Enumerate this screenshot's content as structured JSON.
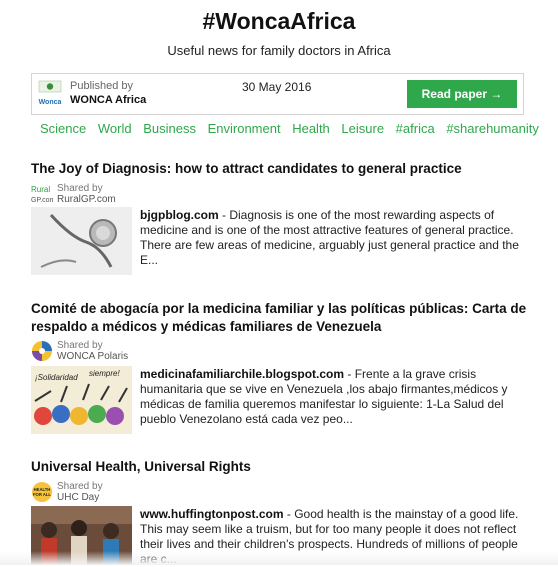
{
  "header": {
    "title": "#WoncaAfrica",
    "subtitle": "Useful news for family doctors in Africa"
  },
  "publisher": {
    "logo_text": "Wonca",
    "published_by_label": "Published by",
    "name": "WONCA Africa",
    "date": "30 May 2016",
    "read_button": "Read paper →"
  },
  "categories": [
    "Science",
    "World",
    "Business",
    "Environment",
    "Health",
    "Leisure",
    "#africa",
    "#sharehumanity"
  ],
  "articles": [
    {
      "title": "The Joy of Diagnosis: how to attract candidates to general practice",
      "shared_label": "Shared by",
      "shared_by": "RuralGP.com",
      "logo_text": "Rural GP.com",
      "source": "bjgpblog.com",
      "summary": " - Diagnosis is one of the most rewarding aspects of medicine and is one of the most attractive features of general practice. There are few areas of medicine, arguably just general practice and the E..."
    },
    {
      "title": "Comité de abogacía por la medicina familiar y las políticas públicas: Carta de respaldo a médicos y médicas familiares de Venezuela",
      "shared_label": "Shared by",
      "shared_by": "WONCA Polaris",
      "source": "medicinafamiliarchile.blogspot.com",
      "summary": " - Frente a la grave crisis humanitaria que se vive en Venezuela ,los abajo firmantes,médicos y médicas de familia  queremos manifestar lo siguiente: 1-La Salud del pueblo Venezolano está cada vez peo...",
      "thumb_text_1": "¡Solidaridad",
      "thumb_text_2": "siempre!"
    },
    {
      "title": "Universal Health, Universal Rights",
      "shared_label": "Shared by",
      "shared_by": "UHC Day",
      "logo_text": "HEALTH FOR ALL",
      "source": "www.huffingtonpost.com",
      "summary": " - Good health is the mainstay of a good life. This may seem like a truism, but for too many people it does not reflect their lives and their children's prospects. Hundreds of millions of people are c..."
    }
  ],
  "colors": {
    "accent": "#2ea84a",
    "text": "#222222"
  }
}
